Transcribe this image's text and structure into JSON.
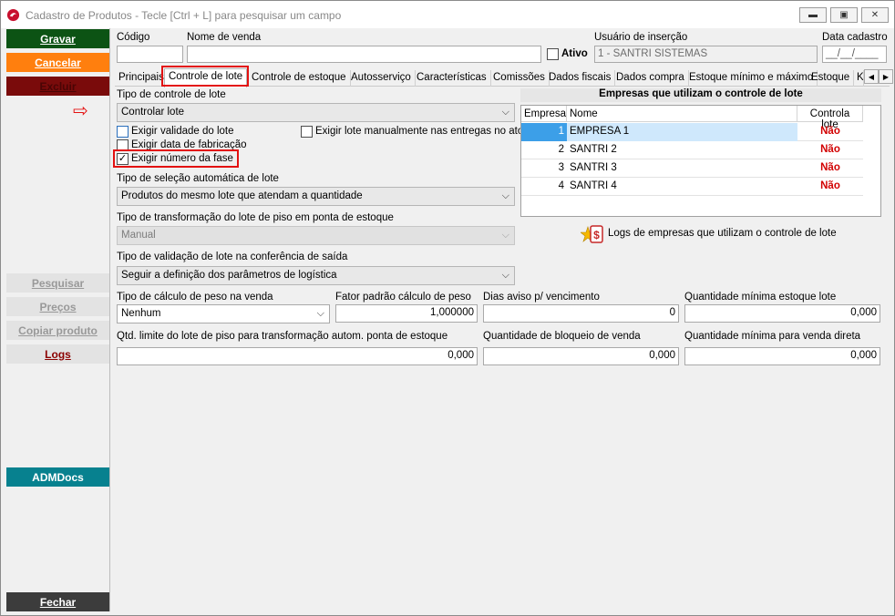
{
  "window": {
    "title": "Cadastro de Produtos - Tecle [Ctrl + L] para pesquisar um campo",
    "minimize": "▬",
    "maximize": "▣",
    "close": "✕"
  },
  "sidebar": {
    "gravar": "Gravar",
    "cancelar": "Cancelar",
    "excluir": "Excluir",
    "pesquisar": "Pesquisar",
    "precos": "Preços",
    "copiar": "Copiar produto",
    "logs": "Logs",
    "admdocs": "ADMDocs",
    "fechar": "Fechar"
  },
  "header": {
    "codigo_label": "Código",
    "codigo_value": "",
    "nome_label": "Nome de venda",
    "nome_value": "",
    "ativo_label": "Ativo",
    "usuario_label": "Usuário de inserção",
    "usuario_value": "1 - SANTRI SISTEMAS",
    "data_label": "Data cadastro",
    "data_value": "__/__/____"
  },
  "tabs": [
    "Principais",
    "Controle de lote",
    "Controle de estoque",
    "Autosserviço",
    "Características",
    "Comissões",
    "Dados fiscais",
    "Dados compra",
    "Estoque mínimo e máximo",
    "Estoque",
    "K"
  ],
  "tab_scroll": {
    "left": "◀",
    "right": "▶"
  },
  "lote": {
    "tipo_controle_label": "Tipo de controle de lote",
    "tipo_controle_value": "Controlar lote",
    "arrow": "⇨",
    "exigir_validade": "Exigir validade do lote",
    "exigir_manual": "Exigir lote manualmente nas entregas no ato",
    "exigir_fabricacao": "Exigir data de fabricação",
    "exigir_fase": "Exigir número da fase",
    "exigir_fase_check": "✓",
    "selecao_label": "Tipo de seleção automática de lote",
    "selecao_value": "Produtos do mesmo lote que atendam a quantidade",
    "transformacao_label": "Tipo de transformação do lote de piso em ponta de estoque",
    "transformacao_value": "Manual",
    "validacao_label": "Tipo de validação de lote na conferência de saída",
    "validacao_value": "Seguir a definição dos parâmetros de logística",
    "caret": "⌵"
  },
  "empresas": {
    "title": "Empresas que utilizam o controle de lote",
    "headers": [
      "Empresa",
      "Nome",
      "Controla lote"
    ],
    "rows": [
      {
        "id": "1",
        "nome": "EMPRESA 1",
        "controla": "Não"
      },
      {
        "id": "2",
        "nome": "SANTRI 2",
        "controla": "Não"
      },
      {
        "id": "3",
        "nome": "SANTRI 3",
        "controla": "Não"
      },
      {
        "id": "4",
        "nome": "SANTRI 4",
        "controla": "Não"
      }
    ],
    "logs_label": "Logs de empresas que utilizam o controle de lote"
  },
  "peso": {
    "calculo_label": "Tipo de cálculo de peso na venda",
    "calculo_value": "Nenhum",
    "fator_label": "Fator padrão cálculo de peso",
    "fator_value": "1,000000",
    "dias_label": "Dias aviso p/ vencimento",
    "dias_value": "0",
    "qtd_min_label": "Quantidade mínima estoque lote",
    "qtd_min_value": "0,000",
    "limite_label": "Qtd. limite do lote de piso para transformação autom. ponta de estoque",
    "limite_value": "0,000",
    "bloqueio_label": "Quantidade de bloqueio de venda",
    "bloqueio_value": "0,000",
    "min_direta_label": "Quantidade mínima para venda direta",
    "min_direta_value": "0,000"
  }
}
